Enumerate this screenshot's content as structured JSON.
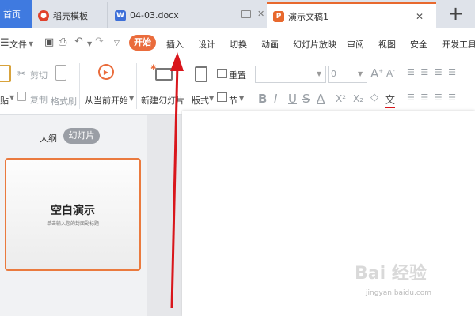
{
  "tabs": {
    "home": "首页",
    "daoke": "稻壳模板",
    "doc": "04-03.docx",
    "ppt": "演示文稿1",
    "plus": "+"
  },
  "menu": {
    "file": "文件",
    "items": [
      "开始",
      "插入",
      "设计",
      "切换",
      "动画",
      "幻灯片放映",
      "审阅",
      "视图",
      "安全",
      "开发工具"
    ]
  },
  "ribbon": {
    "cut": "剪切",
    "paste_partial": "贴",
    "copy": "复制",
    "format_painter": "格式刷",
    "play_from_current": "从当前开始",
    "new_slide": "新建幻灯片",
    "layout": "版式",
    "section": "节",
    "reset": "重置",
    "font_size": "0",
    "text_a": "A",
    "bold": "B",
    "italic": "I",
    "underline": "U",
    "strike": "S",
    "font_color": "A",
    "superscript": "X²",
    "subscript": "X₂",
    "clear_format": "◇",
    "wen": "文"
  },
  "leftpane": {
    "outline": "大纲",
    "slides": "幻灯片",
    "thumb_title": "空白演示",
    "thumb_subtitle": "单击输入您的封面副标题"
  },
  "watermark": {
    "text": "Bai 经验",
    "url": "jingyan.baidu.com"
  },
  "colors": {
    "accent": "#ea6c3c",
    "home_tab": "#3f7ae0",
    "arrow": "#d9161c"
  }
}
